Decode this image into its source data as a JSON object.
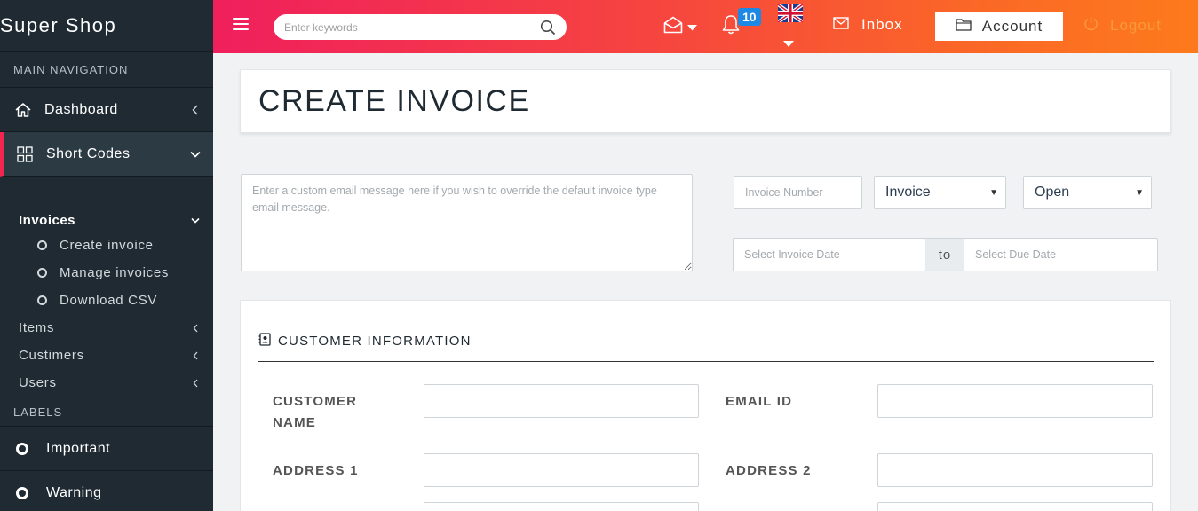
{
  "sidebar": {
    "brand": "Super Shop",
    "main_heading": "MAIN NAVIGATION",
    "dashboard": "Dashboard",
    "short_codes": "Short Codes",
    "invoices": "Invoices",
    "invoice_items": [
      "Create invoice",
      "Manage invoices",
      "Download CSV"
    ],
    "items": "Items",
    "customers": "Custimers",
    "users": "Users",
    "labels_heading": "LABELS",
    "labels": [
      "Important",
      "Warning"
    ]
  },
  "topbar": {
    "search_placeholder": "Enter keywords",
    "notification_count": "10",
    "inbox": "Inbox",
    "account": "Account",
    "logout": "Logout"
  },
  "page": {
    "title": "CREATE INVOICE",
    "message_placeholder": "Enter a custom email message here if you wish to override the default invoice type email message.",
    "invoice_number_placeholder": "Invoice Number",
    "type_select": "Invoice",
    "status_select": "Open",
    "invoice_date_placeholder": "Select Invoice Date",
    "to_label": "to",
    "due_date_placeholder": "Select Due Date"
  },
  "customer": {
    "heading": "CUSTOMER INFORMATION",
    "customer_name_line1": "CUSTOMER",
    "customer_name_line2": "NAME",
    "email": "EMAIL ID",
    "address1": "ADDRESS 1",
    "address2": "ADDRESS 2"
  },
  "colors": {
    "sidebar_bg": "#1f2a32",
    "accent_pink": "#f01f5d",
    "accent_orange": "#fd7a1c",
    "badge_blue": "#1e88e5"
  }
}
